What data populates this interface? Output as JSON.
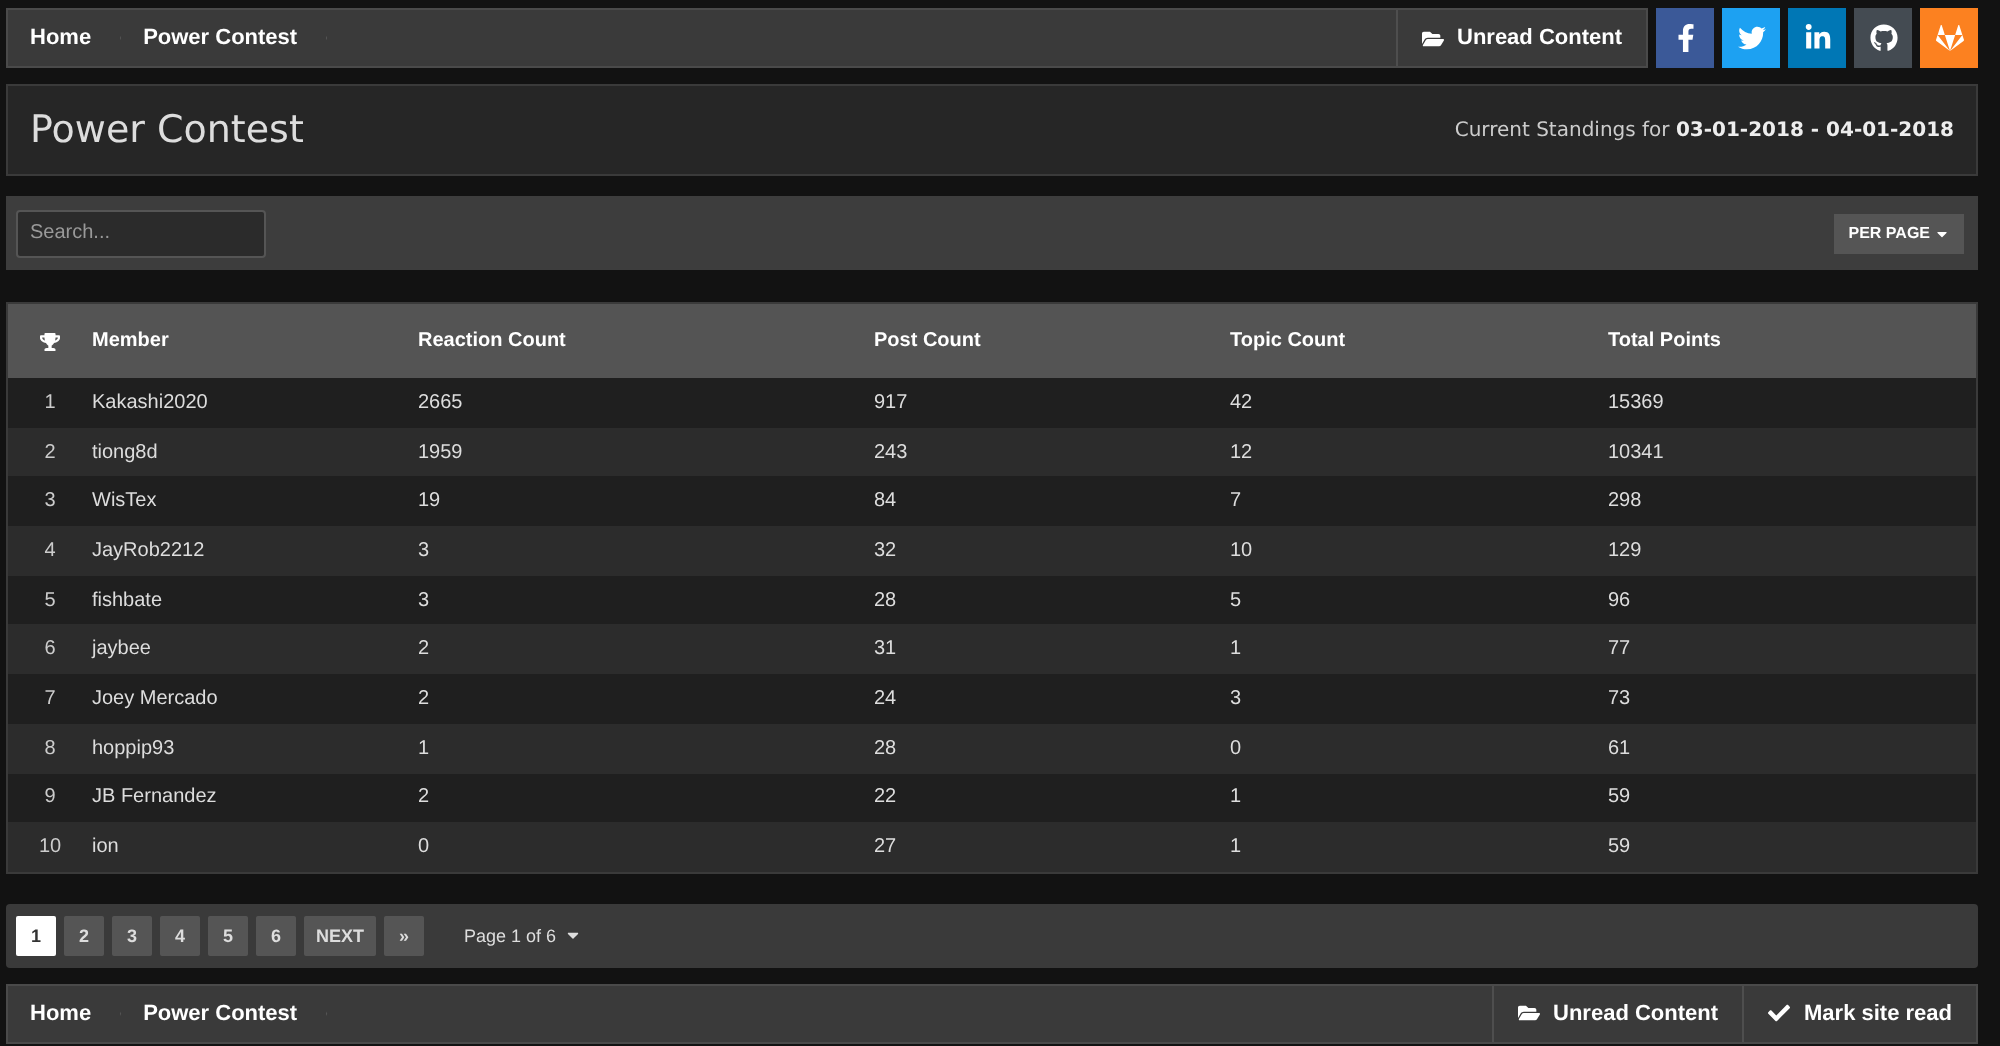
{
  "breadcrumbs": [
    "Home",
    "Power Contest"
  ],
  "top_links": [
    {
      "kind": "unread",
      "label": "Unread Content"
    }
  ],
  "social": [
    {
      "kind": "facebook",
      "color": "#3b5998"
    },
    {
      "kind": "twitter",
      "color": "#1da1f2"
    },
    {
      "kind": "linkedin",
      "color": "#0077b5"
    },
    {
      "kind": "github",
      "color": "#444b52"
    },
    {
      "kind": "gitlab",
      "color": "#fc8120"
    }
  ],
  "page_title": "Power Contest",
  "standings": "Current Standings for **03-01-2018 - 04-01-2018**",
  "search": {
    "placeholder": "Search..."
  },
  "per_page": "PER PAGE",
  "table": {
    "columns": [
      "",
      "Member",
      "Reaction Count",
      "Post Count",
      "Topic Count",
      "Total Points"
    ],
    "rows": [
      [
        "1",
        "Kakashi2020",
        "2665",
        "917",
        "42",
        "15369"
      ],
      [
        "2",
        "tiong8d",
        "1959",
        "243",
        "12",
        "10341"
      ],
      [
        "3",
        "WisTex",
        "19",
        "84",
        "7",
        "298"
      ],
      [
        "4",
        "JayRob2212",
        "3",
        "32",
        "10",
        "129"
      ],
      [
        "5",
        "fishbate",
        "3",
        "28",
        "5",
        "96"
      ],
      [
        "6",
        "jaybee",
        "2",
        "31",
        "1",
        "77"
      ],
      [
        "7",
        "Joey Mercado",
        "2",
        "24",
        "3",
        "73"
      ],
      [
        "8",
        "hoppip93",
        "1",
        "28",
        "0",
        "61"
      ],
      [
        "9",
        "JB Fernandez",
        "2",
        "22",
        "1",
        "59"
      ],
      [
        "10",
        "ion",
        "0",
        "27",
        "1",
        "59"
      ]
    ]
  },
  "pagination": {
    "pages": [
      {
        "label": "1",
        "selected": true
      },
      {
        "label": "2",
        "selected": false
      },
      {
        "label": "3",
        "selected": false
      },
      {
        "label": "4",
        "selected": false
      },
      {
        "label": "5",
        "selected": false
      },
      {
        "label": "6",
        "selected": false
      }
    ],
    "next": "NEXT",
    "last": "»",
    "page_info": "Page 1 of 6"
  },
  "footer_breadcrumbs": [
    "Home",
    "Power Contest"
  ],
  "footer_links": [
    {
      "kind": "unread",
      "label": "Unread Content"
    },
    {
      "kind": "mark_read",
      "label": "Mark site read"
    }
  ]
}
